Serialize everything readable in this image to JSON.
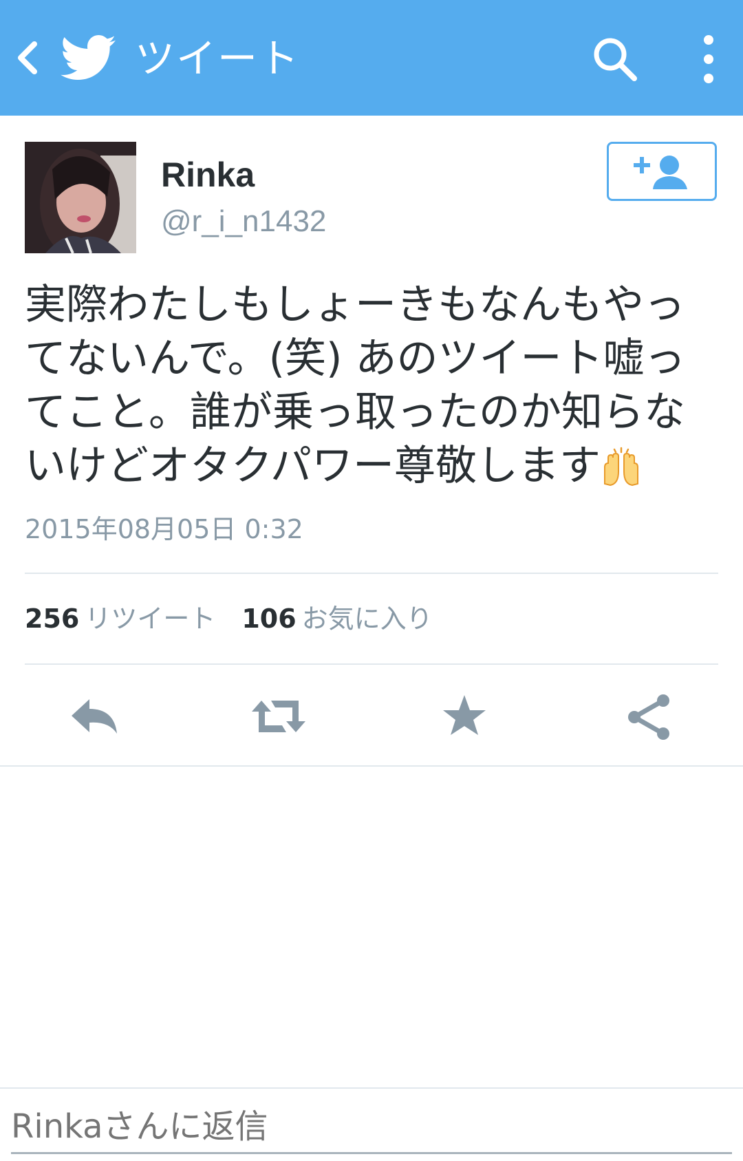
{
  "header": {
    "title": "ツイート",
    "back_icon": "chevron-left-icon",
    "logo_icon": "twitter-bird-icon",
    "search_icon": "search-icon",
    "more_icon": "more-vertical-icon",
    "bg_color": "#55acee"
  },
  "user": {
    "name": "Rinka",
    "handle": "@r_i_n1432",
    "follow_icon": "add-user-icon"
  },
  "tweet": {
    "text": "実際わたしもしょーきもなんもやってないんで。(笑) あのツイート嘘ってこと。誰が乗っ取ったのか知らないけどオタクパワー尊敬します",
    "emoji": "raised-hands-icon",
    "timestamp": "2015年08月05日 0:32"
  },
  "stats": {
    "retweets_count": "256",
    "retweets_label": "リツイート",
    "favorites_count": "106",
    "favorites_label": "お気に入り"
  },
  "actions": {
    "reply": "reply-icon",
    "retweet": "retweet-icon",
    "favorite": "star-icon",
    "share": "share-icon",
    "icon_color": "#8899a6"
  },
  "reply_box": {
    "placeholder": "Rinkaさんに返信"
  }
}
